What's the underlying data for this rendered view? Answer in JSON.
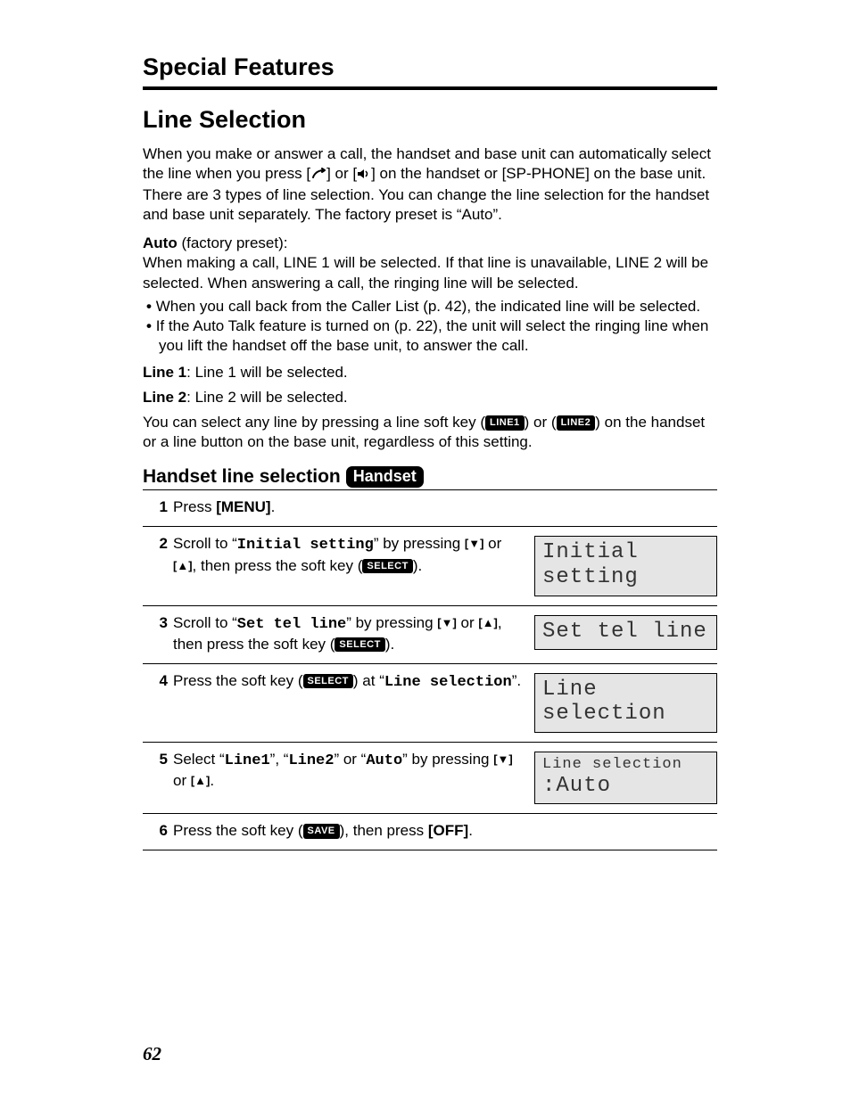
{
  "chapter": "Special Features",
  "section": "Line Selection",
  "intro": "When you make or answer a call, the handset and base unit can automatically select the line when you press [",
  "intro2": "] or [",
  "intro3": "] on the handset or [SP-PHONE] on the base unit. There are 3 types of line selection. You can change the line selection for the handset and base unit separately. The factory preset is “Auto”.",
  "auto_label": "Auto",
  "auto_suffix": " (factory preset):",
  "auto_body": "When making a call, LINE 1 will be selected. If that line is unavailable, LINE 2 will be selected. When answering a call, the ringing line will be selected.",
  "bullets": {
    "b1": "When you call back from the Caller List (p. 42), the indicated line will be selected.",
    "b2": "If the Auto Talk feature is turned on (p. 22), the unit will select the ringing line when you lift the handset off the base unit, to answer the call."
  },
  "line1_label": "Line 1",
  "line1_body": ": Line 1 will be selected.",
  "line2_label": "Line 2",
  "line2_body": ": Line 2 will be selected.",
  "softkey_note_a": "You can select any line by pressing a line soft key (",
  "softkey_chip1": "LINE1",
  "softkey_note_b": ") or (",
  "softkey_chip2": "LINE2",
  "softkey_note_c": ") on the handset or a line button on the base unit, regardless of this setting.",
  "subsection": "Handset line selection",
  "handset_badge": "Handset",
  "steps": {
    "s1": {
      "num": "1",
      "pre": "Press ",
      "bold": "[MENU]",
      "post": "."
    },
    "s2": {
      "num": "2",
      "a": "Scroll to “",
      "mono": "Initial setting",
      "b": "” by pressing ",
      "c": " or ",
      "d": ", then press the soft key (",
      "chip": "SELECT",
      "e": ").",
      "screen": "Initial setting"
    },
    "s3": {
      "num": "3",
      "a": "Scroll to “",
      "mono": "Set tel line",
      "b": "” by pressing ",
      "c": " or ",
      "d": ", then press the soft key (",
      "chip": "SELECT",
      "e": ").",
      "screen": "Set tel line"
    },
    "s4": {
      "num": "4",
      "a": "Press the soft key (",
      "chip": "SELECT",
      "b": ") at “",
      "mono": "Line selection",
      "c": "”.",
      "screen": "Line selection"
    },
    "s5": {
      "num": "5",
      "a": "Select “",
      "m1": "Line1",
      "b": "”, “",
      "m2": "Line2",
      "c": "” or “",
      "m3": "Auto",
      "d": "” by pressing ",
      "e": " or ",
      "f": ".",
      "screen_l1": "Line selection",
      "screen_l2": ":Auto"
    },
    "s6": {
      "num": "6",
      "a": "Press the soft key (",
      "chip": "SAVE",
      "b": "), then press ",
      "bold": "[OFF]",
      "c": "."
    }
  },
  "glyphs": {
    "down": "[▼]",
    "up": "[▲]"
  },
  "page_number": "62"
}
